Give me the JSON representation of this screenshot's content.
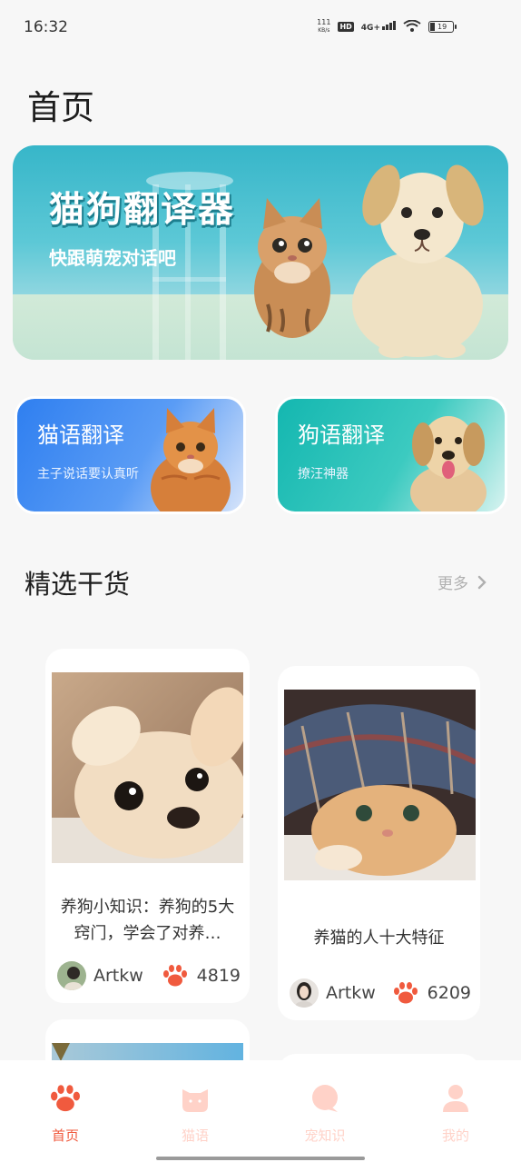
{
  "status_bar": {
    "time": "16:32",
    "net_speed_value": "111",
    "net_speed_unit": "KB/s",
    "hd": "HD",
    "network": "4G+",
    "battery": "19"
  },
  "page": {
    "title": "首页"
  },
  "hero": {
    "title": "猫狗翻译器",
    "subtitle": "快跟萌宠对话吧"
  },
  "translate_cards": [
    {
      "title": "猫语翻译",
      "subtitle": "主子说话要认真听"
    },
    {
      "title": "狗语翻译",
      "subtitle": "撩汪神器"
    }
  ],
  "section": {
    "title": "精选干货",
    "more_label": "更多"
  },
  "articles": [
    {
      "title": "养狗小知识：养狗的5大窍门，学会了对养…",
      "author": "Artkw",
      "likes": "4819"
    },
    {
      "title": "养猫的人十大特征",
      "author": "Artkw",
      "likes": "6209"
    }
  ],
  "tabs": [
    {
      "label": "首页",
      "active": true
    },
    {
      "label": "猫语",
      "active": false
    },
    {
      "label": "宠知识",
      "active": false
    },
    {
      "label": "我的",
      "active": false
    }
  ],
  "colors": {
    "accent": "#f05a3e",
    "inactive_tab": "#ffd2c8",
    "cat_card": "#2f7ff0",
    "dog_card": "#14b7b0"
  }
}
